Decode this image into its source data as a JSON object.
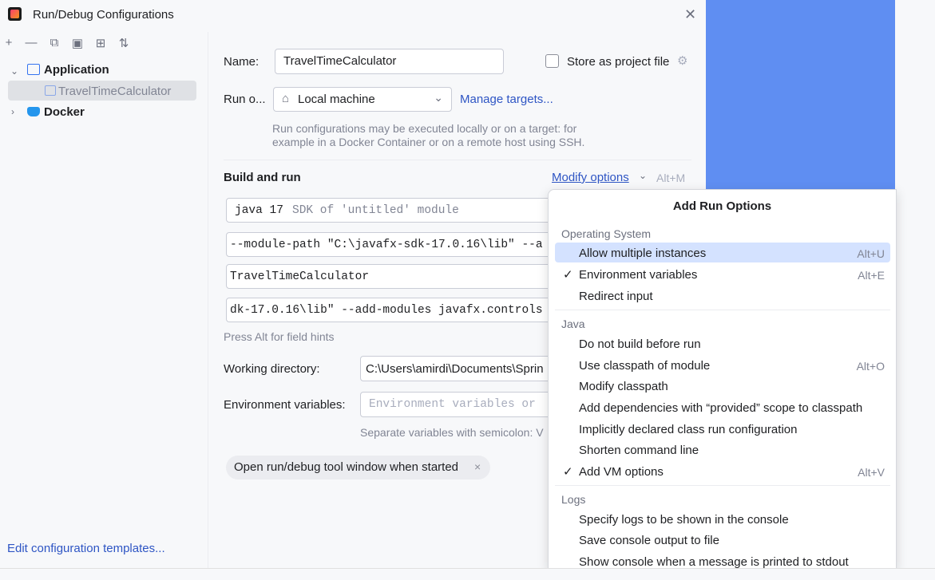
{
  "window": {
    "title": "Run/Debug Configurations"
  },
  "tree": {
    "application": "Application",
    "config": "TravelTimeCalculator",
    "docker": "Docker",
    "edit_templates": "Edit configuration templates..."
  },
  "form": {
    "name_label": "Name:",
    "name_value": "TravelTimeCalculator",
    "store_label": "Store as project file",
    "run_on_label": "Run o...",
    "run_on_value": "Local machine",
    "manage_targets": "Manage targets...",
    "run_hint_1": "Run configurations may be executed locally or on a target: for",
    "run_hint_2": "example in a Docker Container or on a remote host using SSH.",
    "build_run": "Build and run",
    "modify_options": "Modify options",
    "modify_shortcut": "Alt+M",
    "sdk_value": "java 17",
    "sdk_hint": "SDK of 'untitled' module",
    "vm_options": "--module-path \"C:\\javafx-sdk-17.0.16\\lib\" --a",
    "main_class": "TravelTimeCalculator",
    "program_args": "dk-17.0.16\\lib\" --add-modules javafx.controls",
    "alt_hint": "Press Alt for field hints",
    "workdir_label": "Working directory:",
    "workdir_value": "C:\\Users\\amirdi\\Documents\\Sprin",
    "env_label": "Environment variables:",
    "env_placeholder": "Environment variables or",
    "env_hint": "Separate variables with semicolon: V",
    "chip": "Open run/debug tool window when started"
  },
  "popup": {
    "title": "Add Run Options",
    "sec_os": "Operating System",
    "allow_multi": "Allow multiple instances",
    "allow_multi_sc": "Alt+U",
    "env_vars": "Environment variables",
    "env_vars_sc": "Alt+E",
    "redirect": "Redirect input",
    "sec_java": "Java",
    "no_build": "Do not build before run",
    "use_cp": "Use classpath of module",
    "use_cp_sc": "Alt+O",
    "modify_cp": "Modify classpath",
    "add_deps": "Add dependencies with “provided” scope to classpath",
    "implicit": "Implicitly declared class run configuration",
    "shorten": "Shorten command line",
    "add_vm": "Add VM options",
    "add_vm_sc": "Alt+V",
    "sec_logs": "Logs",
    "spec_logs": "Specify logs to be shown in the console",
    "save_console": "Save console output to file",
    "show_console": "Show console when a message is printed to stdout"
  },
  "colors": {
    "accent": "#2e55c4",
    "highlight": "#d4e2ff",
    "right_bg": "#5f8ef2"
  }
}
